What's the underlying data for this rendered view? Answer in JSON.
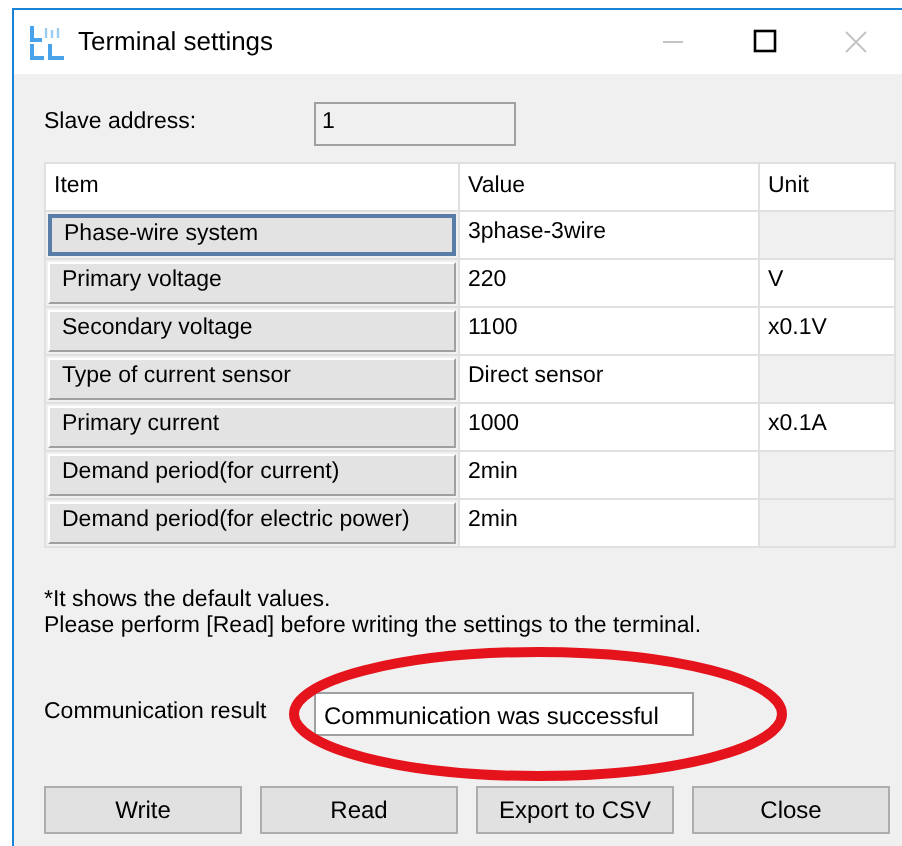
{
  "window": {
    "title": "Terminal settings",
    "controls": [
      {
        "kind": "minimize",
        "disabled": true
      },
      {
        "kind": "maximize",
        "disabled": false
      },
      {
        "kind": "close",
        "disabled": true
      }
    ]
  },
  "slave_address": {
    "label": "Slave address:",
    "value": "1"
  },
  "table": {
    "columns": [
      "Item",
      "Value",
      "Unit"
    ],
    "rows": [
      {
        "item": "Phase-wire system",
        "value": "3phase-3wire",
        "selected": true
      },
      {
        "item": "Primary voltage",
        "value": "220",
        "unit": "V",
        "selected": false
      },
      {
        "item": "Secondary voltage",
        "value": "1100",
        "unit": "x0.1V",
        "selected": false
      },
      {
        "item": "Type of current sensor",
        "value": "Direct sensor",
        "selected": false
      },
      {
        "item": "Primary current",
        "value": "1000",
        "unit": "x0.1A",
        "selected": false
      },
      {
        "item": "Demand period(for current)",
        "value": "2min",
        "selected": false
      },
      {
        "item": "Demand period(for electric power)",
        "value": "2min",
        "selected": false
      }
    ]
  },
  "notes": [
    "*It shows the default values.",
    "Please perform [Read] before writing the settings to the terminal."
  ],
  "communication_result": {
    "label": "Communication result",
    "value": "Communication was successful",
    "highlighted": true
  },
  "buttons": [
    "Write",
    "Read",
    "Export to CSV",
    "Close"
  ]
}
